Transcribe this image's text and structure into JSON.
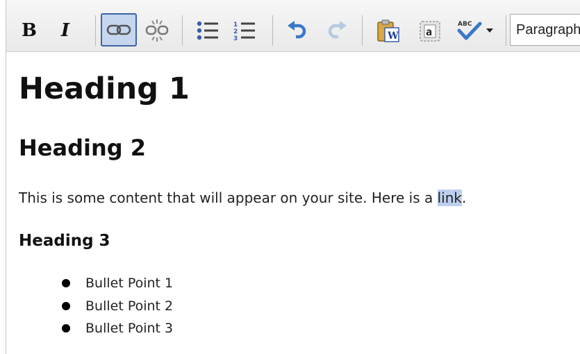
{
  "toolbar": {
    "buttons": [
      {
        "name": "bold",
        "label": "B",
        "icon": "bold-icon"
      },
      {
        "name": "italic",
        "label": "I",
        "icon": "italic-icon"
      },
      {
        "name": "link",
        "icon": "link-icon",
        "active": true
      },
      {
        "name": "unlink",
        "icon": "unlink-icon"
      },
      {
        "name": "bullet-list",
        "icon": "bullet-list-icon"
      },
      {
        "name": "numbered-list",
        "icon": "numbered-list-icon"
      },
      {
        "name": "undo",
        "icon": "undo-icon"
      },
      {
        "name": "redo",
        "icon": "redo-icon",
        "disabled": true
      },
      {
        "name": "paste-from-word",
        "icon": "paste-word-icon",
        "glyph": "W"
      },
      {
        "name": "paste-as-text",
        "icon": "paste-text-icon",
        "glyph": "a"
      },
      {
        "name": "spellcheck",
        "icon": "spellcheck-icon",
        "glyph": "ABC"
      }
    ],
    "format_select": {
      "value": "Paragraph"
    }
  },
  "content": {
    "h1": "Heading 1",
    "h2": "Heading 2",
    "paragraph_text": "This is some content that will appear on your site. Here is a ",
    "link_text": "link",
    "paragraph_end": ".",
    "h3": "Heading 3",
    "bullets": [
      "Bullet Point 1",
      "Bullet Point 2",
      "Bullet Point 3"
    ]
  },
  "colors": {
    "toolbar_bg": "#ececec",
    "link_highlight": "#bcd0ee",
    "active_button_border": "#3c64a8",
    "undo_blue": "#3a78c8"
  }
}
